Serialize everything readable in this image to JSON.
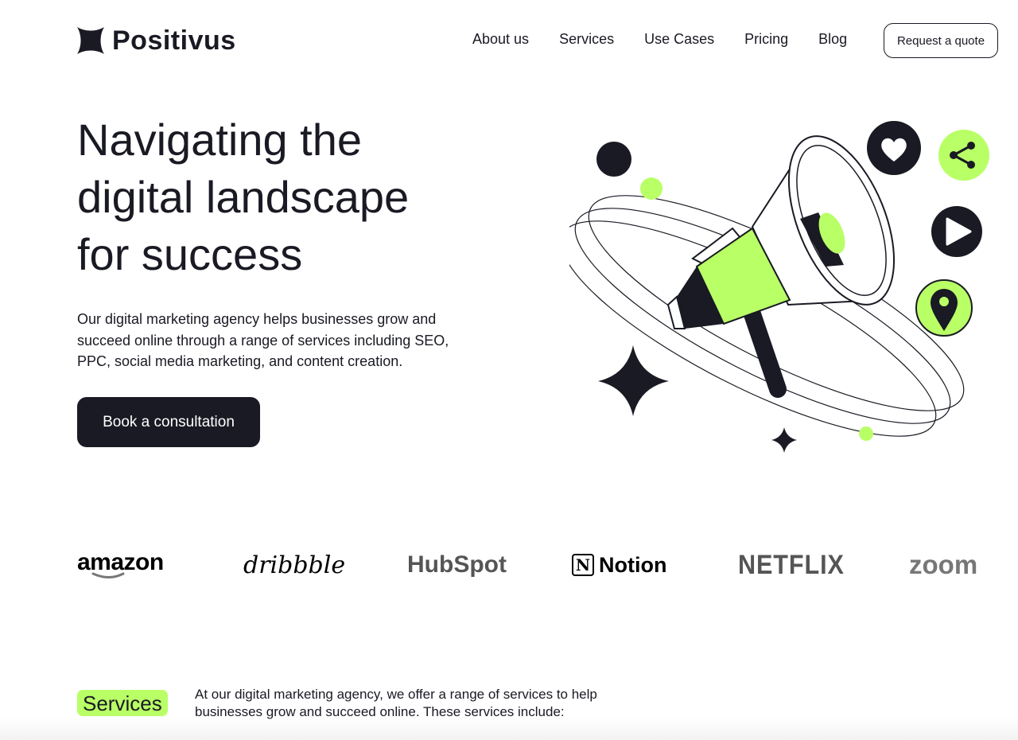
{
  "header": {
    "brand_name": "Positivus",
    "nav": [
      "About us",
      "Services",
      "Use Cases",
      "Pricing",
      "Blog"
    ],
    "cta_label": "Request a quote"
  },
  "hero": {
    "title_lines": [
      "Navigating the",
      "digital landscape",
      "for success"
    ],
    "description": "Our digital marketing agency helps businesses grow and succeed online through a range of services including SEO, PPC, social media marketing, and content creation.",
    "cta_label": "Book a consultation"
  },
  "clients": [
    "amazon",
    "dribbble",
    "HubSpot",
    "Notion",
    "NETFLIX",
    "zoom"
  ],
  "services": {
    "badge": "Services",
    "description": "At our digital marketing agency, we offer a range of services to help businesses grow and succeed online. These services include:"
  },
  "colors": {
    "accent": "#B9FF66",
    "dark": "#191A23",
    "background": "#FFFFFF"
  }
}
